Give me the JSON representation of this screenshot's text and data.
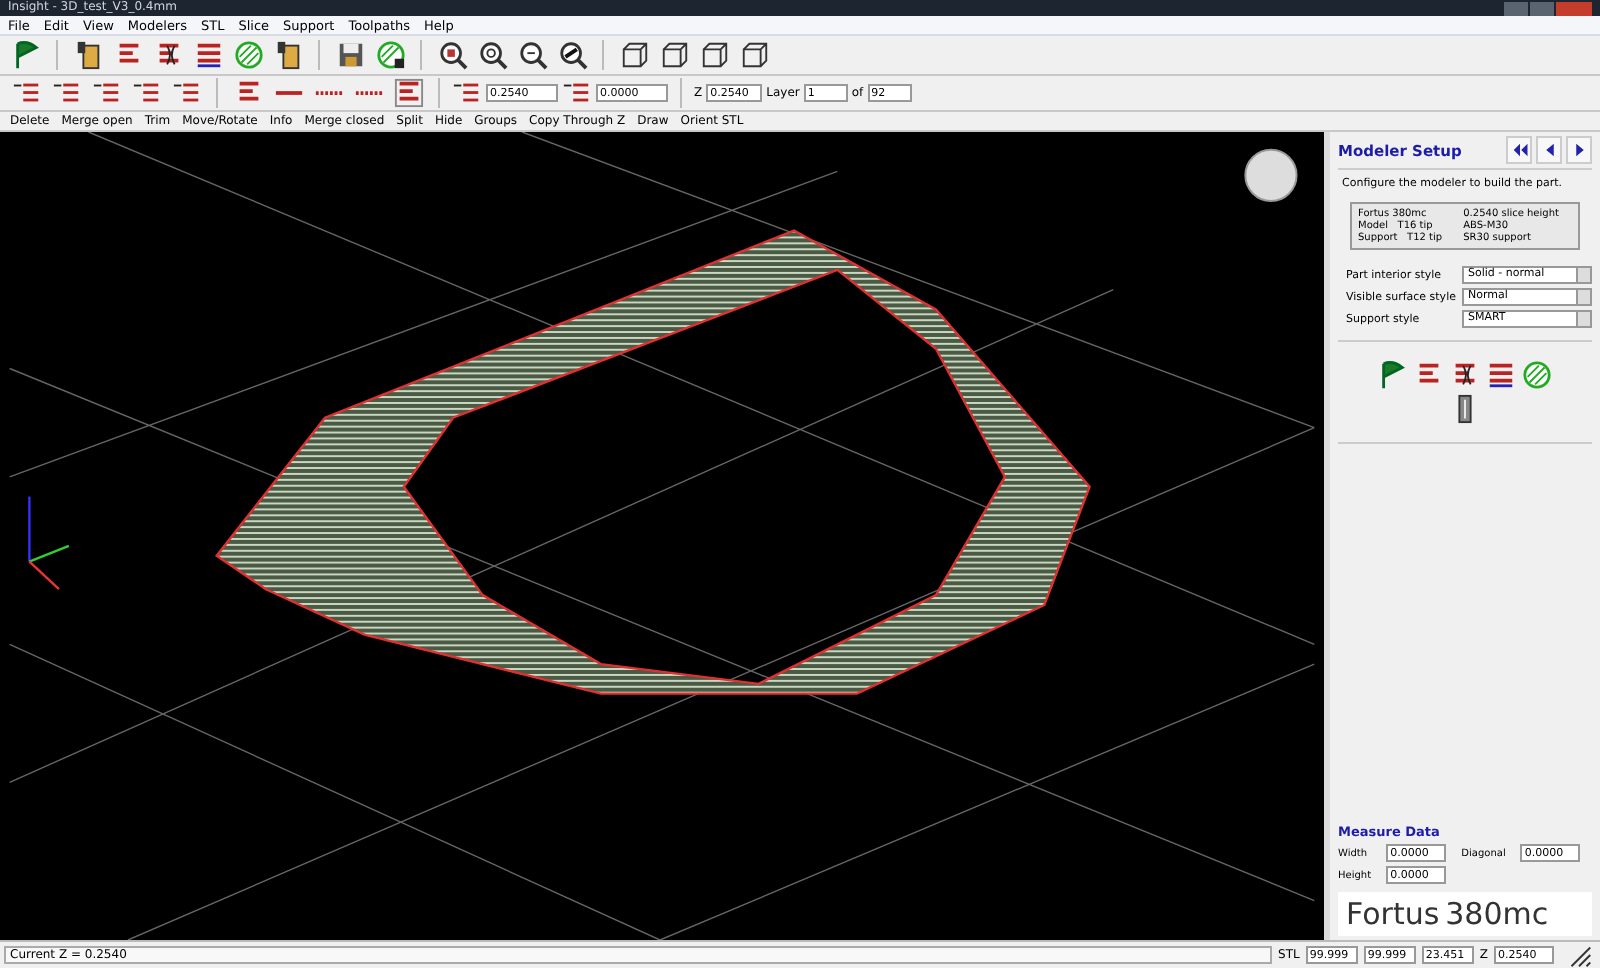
{
  "window": {
    "title": "Insight - 3D_test_V3_0.4mm"
  },
  "menu": [
    "File",
    "Edit",
    "View",
    "Modelers",
    "STL",
    "Slice",
    "Support",
    "Toolpaths",
    "Help"
  ],
  "layer_toolbar": {
    "width_a": "0.2540",
    "width_b": "0.0000",
    "z_label": "Z",
    "z_value": "0.2540",
    "layer_label": "Layer",
    "layer_value": "1",
    "of_label": "of",
    "of_value": "92"
  },
  "edit_toolbar": [
    "Delete",
    "Merge open",
    "Trim",
    "Move/Rotate",
    "Info",
    "Merge closed",
    "Split",
    "Hide",
    "Groups",
    "Copy Through Z",
    "Draw",
    "Orient STL"
  ],
  "panel": {
    "title": "Modeler Setup",
    "description": "Configure the modeler to build the part.",
    "info": [
      [
        "Fortus 380mc",
        "0.2540 slice height"
      ],
      [
        "Model   T16 tip",
        "ABS-M30"
      ],
      [
        "Support   T12 tip",
        "SR30 support"
      ]
    ],
    "styles": [
      {
        "label": "Part interior style",
        "value": "Solid - normal"
      },
      {
        "label": "Visible surface style",
        "value": "Normal"
      },
      {
        "label": "Support style",
        "value": "SMART"
      }
    ],
    "measure": {
      "title": "Measure Data",
      "fields": [
        {
          "label": "Width",
          "value": "0.0000"
        },
        {
          "label": "Diagonal",
          "value": "0.0000"
        },
        {
          "label": "Height",
          "value": "0.0000"
        }
      ]
    },
    "brand": {
      "name": "Fortus",
      "model": "380mc"
    }
  },
  "status_bar": {
    "message": "Current Z = 0.2540",
    "stl_label": "STL",
    "stl_values": [
      "99.999",
      "99.999",
      "23.451"
    ],
    "z_label": "Z",
    "z_value": "0.2540"
  }
}
